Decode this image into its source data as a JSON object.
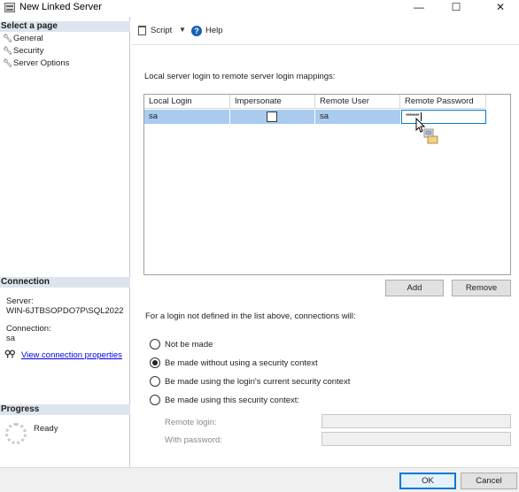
{
  "window": {
    "title": "New Linked Server",
    "icon": "server-icon",
    "controls": {
      "minimize": "—",
      "maximize": "☐",
      "close": "✕"
    }
  },
  "left_pane": {
    "select_page_header": "Select a page",
    "pages": [
      {
        "label": "General",
        "icon": "wrench-icon"
      },
      {
        "label": "Security",
        "icon": "wrench-icon"
      },
      {
        "label": "Server Options",
        "icon": "wrench-icon"
      }
    ],
    "connection_header": "Connection",
    "server_label": "Server:",
    "server_value": "WIN-6JTBSOPDO7P\\SQL2022",
    "connection_label": "Connection:",
    "connection_value": "sa",
    "view_connection_link": "View connection properties",
    "progress_header": "Progress",
    "progress_status": "Ready"
  },
  "toolbar": {
    "script_label": "Script",
    "help_label": "Help"
  },
  "mappings": {
    "label": "Local server login to remote server login mappings:",
    "columns": [
      "Local Login",
      "Impersonate",
      "Remote User",
      "Remote Password"
    ],
    "rows": [
      {
        "local_login": "sa",
        "impersonate": false,
        "remote_user": "sa",
        "remote_password": "*******"
      }
    ],
    "add_button": "Add",
    "remove_button": "Remove"
  },
  "undefined_logins": {
    "label": "For a login not defined in the list above, connections will:",
    "options": [
      {
        "label": "Not be made",
        "selected": false
      },
      {
        "label": "Be made without using a security context",
        "selected": true
      },
      {
        "label": "Be made using the login's current security context",
        "selected": false
      },
      {
        "label": "Be made using this security context:",
        "selected": false
      }
    ],
    "remote_login_label": "Remote login:",
    "remote_login_value": "",
    "with_password_label": "With password:",
    "with_password_value": ""
  },
  "footer": {
    "ok_button": "OK",
    "cancel_button": "Cancel"
  },
  "colors": {
    "selected_row": "#a9cbf0",
    "section_header": "#dde4ee",
    "link": "#0000ee",
    "focus_border": "#0078d7"
  }
}
